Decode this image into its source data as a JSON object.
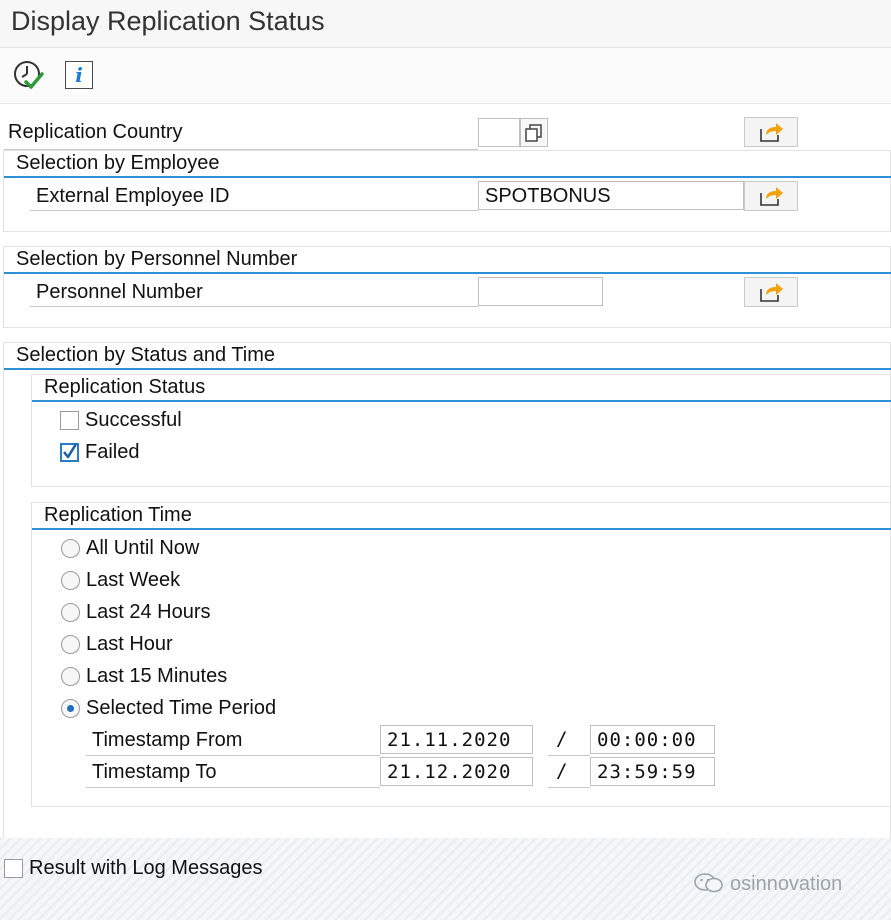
{
  "window": {
    "title": "Display Replication Status"
  },
  "toolbar": {
    "execute_icon": "execute-clock-check-icon",
    "info_icon": "info-icon",
    "info_glyph": "i"
  },
  "country": {
    "label": "Replication Country",
    "value": ""
  },
  "employee": {
    "section": "Selection by Employee",
    "label": "External Employee ID",
    "value": "SPOTBONUS"
  },
  "personnel": {
    "section": "Selection by Personnel Number",
    "label": "Personnel Number",
    "value": ""
  },
  "status_time": {
    "section": "Selection by Status and Time",
    "status": {
      "title": "Replication Status",
      "successful": {
        "label": "Successful",
        "checked": false
      },
      "failed": {
        "label": "Failed",
        "checked": true
      }
    },
    "time": {
      "title": "Replication Time",
      "options": [
        "All Until Now",
        "Last Week",
        "Last 24 Hours",
        "Last Hour",
        "Last 15 Minutes",
        "Selected Time Period"
      ],
      "selected": "Selected Time Period",
      "from": {
        "label": "Timestamp From",
        "date": "21.11.2020",
        "sep": "/",
        "time": "00:00:00"
      },
      "to": {
        "label": "Timestamp To",
        "date": "21.12.2020",
        "sep": "/",
        "time": "23:59:59"
      }
    }
  },
  "log": {
    "label": "Result with Log Messages",
    "checked": false
  },
  "watermark": {
    "text": "osinnovation"
  },
  "colors": {
    "accent_line": "#2f8fd6",
    "arrow": "#f0a30a",
    "check": "#2e9a3a"
  }
}
